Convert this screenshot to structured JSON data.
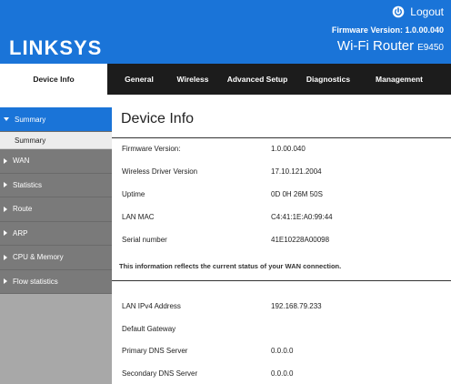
{
  "header": {
    "logout_label": "Logout",
    "firmware_label": "Firmware Version: 1.0.00.040",
    "logo": "LINKSYS",
    "router_name": "Wi-Fi Router",
    "model": "E9450",
    "brand_color": "#1a74d8"
  },
  "nav": {
    "tabs": [
      {
        "label": "Device Info",
        "active": true
      },
      {
        "label": "General"
      },
      {
        "label": "Wireless"
      },
      {
        "label": "Advanced Setup"
      },
      {
        "label": "Diagnostics"
      },
      {
        "label": "Management"
      }
    ]
  },
  "sidebar": {
    "items": [
      {
        "label": "Summary",
        "active": true
      },
      {
        "label": "Summary",
        "sub": true
      },
      {
        "label": "WAN"
      },
      {
        "label": "Statistics"
      },
      {
        "label": "Route"
      },
      {
        "label": "ARP"
      },
      {
        "label": "CPU & Memory"
      },
      {
        "label": "Flow statistics"
      }
    ]
  },
  "main": {
    "title": "Device Info",
    "rows1": [
      {
        "label": "Firmware Version:",
        "value": "1.0.00.040"
      },
      {
        "label": "Wireless Driver Version",
        "value": "17.10.121.2004"
      },
      {
        "label": "Uptime",
        "value": "0D 0H 26M 50S"
      },
      {
        "label": "LAN MAC",
        "value": "C4:41:1E:A0:99:44"
      },
      {
        "label": "Serial number",
        "value": "41E10228A00098"
      }
    ],
    "info_text": "This information reflects the current status of your WAN connection.",
    "rows2": [
      {
        "label": "LAN IPv4 Address",
        "value": "192.168.79.233"
      },
      {
        "label": "Default Gateway",
        "value": ""
      },
      {
        "label": "Primary DNS Server",
        "value": "0.0.0.0"
      },
      {
        "label": "Secondary DNS Server",
        "value": "0.0.0.0"
      }
    ]
  }
}
